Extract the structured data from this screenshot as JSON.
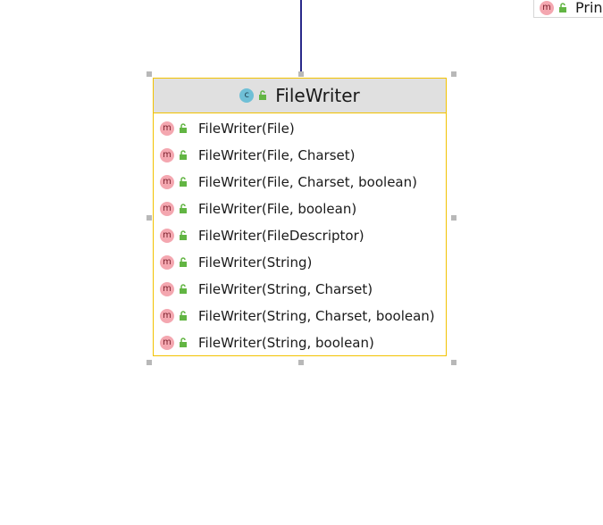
{
  "diagram": {
    "class": {
      "icon_letter": "c",
      "name": "FileWriter",
      "members": [
        {
          "icon_letter": "m",
          "label": "FileWriter(File)"
        },
        {
          "icon_letter": "m",
          "label": "FileWriter(File, Charset)"
        },
        {
          "icon_letter": "m",
          "label": "FileWriter(File, Charset, boolean)"
        },
        {
          "icon_letter": "m",
          "label": "FileWriter(File, boolean)"
        },
        {
          "icon_letter": "m",
          "label": "FileWriter(FileDescriptor)"
        },
        {
          "icon_letter": "m",
          "label": "FileWriter(String)"
        },
        {
          "icon_letter": "m",
          "label": "FileWriter(String, Charset)"
        },
        {
          "icon_letter": "m",
          "label": "FileWriter(String, Charset, boolean)"
        },
        {
          "icon_letter": "m",
          "label": "FileWriter(String, boolean)"
        }
      ]
    },
    "partial_node": {
      "icon_letter": "m",
      "label": "Prin"
    },
    "colors": {
      "class_border": "#f2c200",
      "header_bg": "#e0e0e0",
      "connector": "#2a2a8a",
      "class_icon": "#6fbfd6",
      "method_icon": "#f4a7b0",
      "lock_icon": "#62b543"
    }
  }
}
